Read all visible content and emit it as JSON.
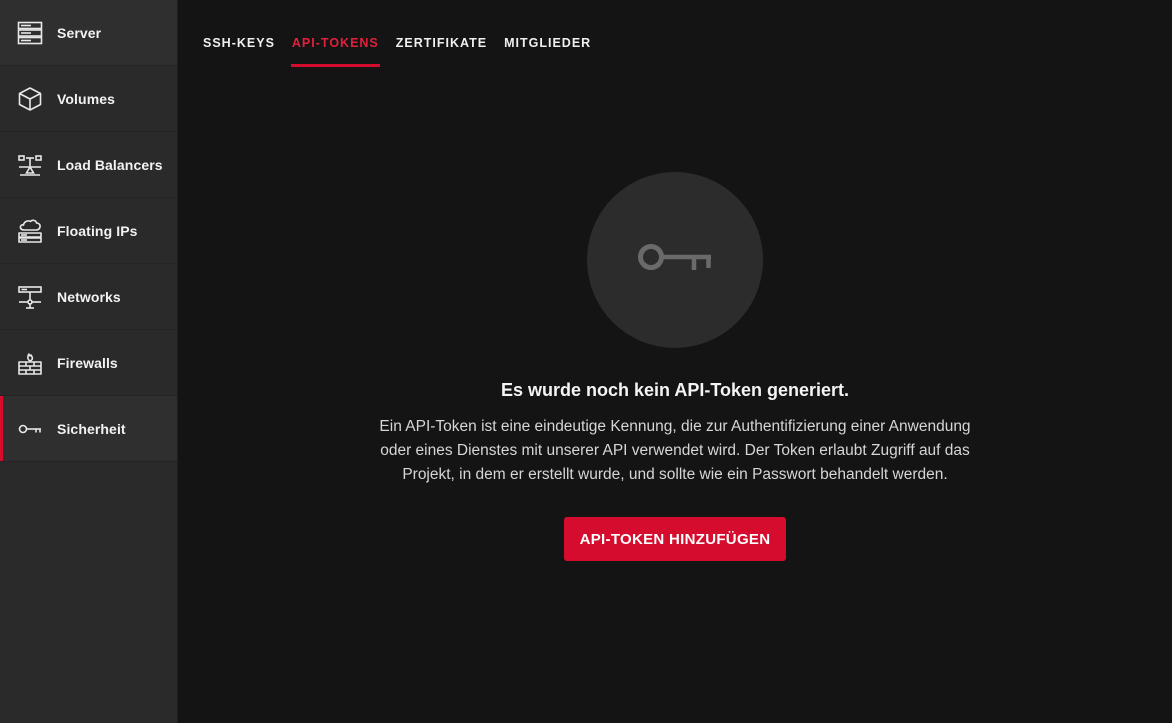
{
  "sidebar": {
    "items": [
      {
        "label": "Server",
        "icon": "server-icon"
      },
      {
        "label": "Volumes",
        "icon": "cube-icon"
      },
      {
        "label": "Load Balancers",
        "icon": "load-balancer-icon"
      },
      {
        "label": "Floating IPs",
        "icon": "cloud-server-icon"
      },
      {
        "label": "Networks",
        "icon": "network-icon"
      },
      {
        "label": "Firewalls",
        "icon": "firewall-icon"
      },
      {
        "label": "Sicherheit",
        "icon": "key-icon",
        "active": true
      }
    ]
  },
  "tabs": [
    {
      "label": "SSH-KEYS"
    },
    {
      "label": "API-TOKENS",
      "active": true
    },
    {
      "label": "ZERTIFIKATE"
    },
    {
      "label": "MITGLIEDER"
    }
  ],
  "empty_state": {
    "icon": "key-icon",
    "title": "Es wurde noch kein API-Token generiert.",
    "description": "Ein API-Token ist eine eindeutige Kennung, die zur Authentifizierung einer Anwendung oder eines Dienstes mit unserer API verwendet wird. Der Token erlaubt Zugriff auf das Projekt, in dem er erstellt wurde, und sollte wie ein Passwort behandelt werden.",
    "button_label": "API-TOKEN HINZUFÜGEN"
  },
  "colors": {
    "accent": "#d50c2d",
    "sidebar_bg": "#2a2a2a",
    "main_bg": "#141414"
  }
}
